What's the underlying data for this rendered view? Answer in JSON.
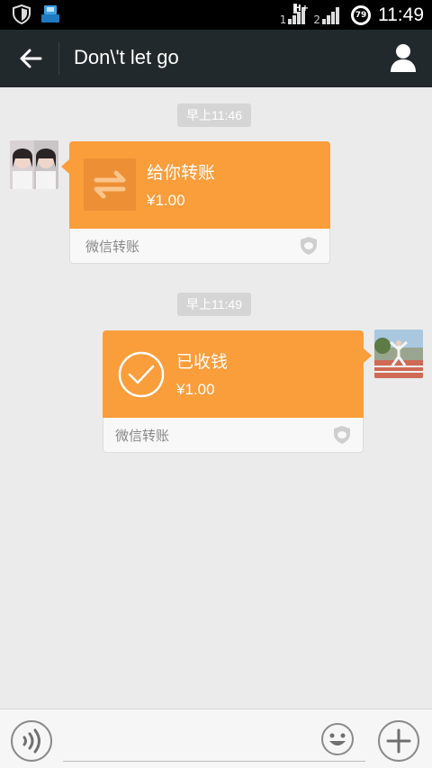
{
  "status_bar": {
    "sim1": "1",
    "sim2": "2",
    "network": "H+",
    "battery": "79",
    "time": "11:49"
  },
  "header": {
    "title": "Don\\'t let go",
    "back_icon": "arrow-left-icon",
    "profile_icon": "person-icon"
  },
  "messages": [
    {
      "timestamp": "早上11:46",
      "direction": "incoming",
      "title": "给你转账",
      "amount": "¥1.00",
      "footer": "微信转账",
      "icon": "transfer-arrows-icon"
    },
    {
      "timestamp": "早上11:49",
      "direction": "outgoing",
      "title": "已收钱",
      "amount": "¥1.00",
      "footer": "微信转账",
      "icon": "check-circle-icon"
    }
  ],
  "input_bar": {
    "placeholder": "",
    "voice_icon": "voice-icon",
    "emoji_icon": "emoji-icon",
    "plus_icon": "plus-icon"
  },
  "colors": {
    "card_orange": "#fa9d3b",
    "header_bg": "#22292c",
    "chat_bg": "#ebebeb"
  }
}
